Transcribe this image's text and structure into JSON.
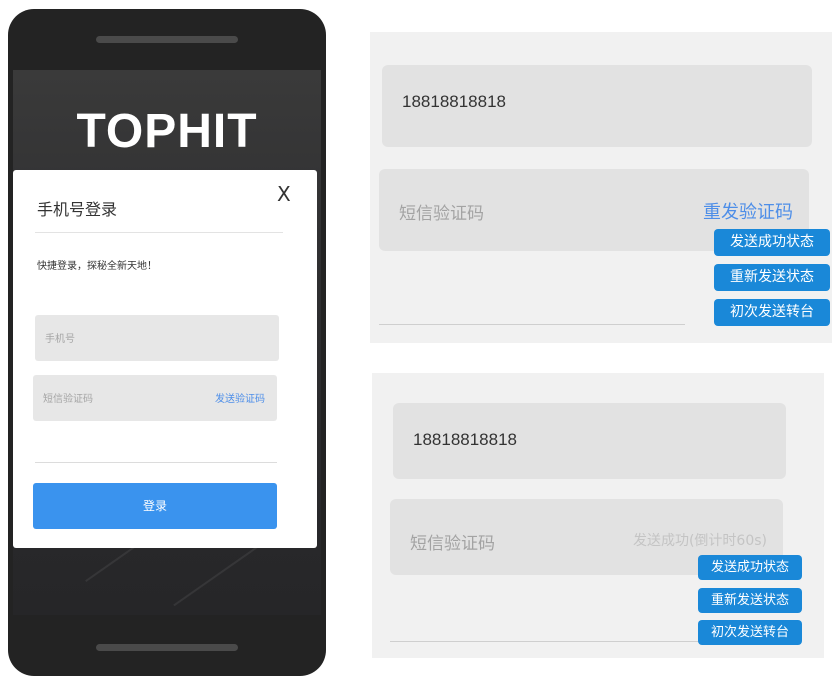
{
  "phone": {
    "logo": "TOPHIT",
    "modal": {
      "title": "手机号登录",
      "close": "X",
      "subtitle": "快捷登录，探秘全新天地！",
      "phone_placeholder": "手机号",
      "code_placeholder": "短信验证码",
      "send_code": "发送验证码",
      "login_button": "登录"
    }
  },
  "panel_resend": {
    "phone_value": "18818818818",
    "code_placeholder": "短信验证码",
    "resend_link": "重发验证码",
    "buttons": [
      "发送成功状态",
      "重新发送状态",
      "初次发送转台"
    ]
  },
  "panel_countdown": {
    "phone_value": "18818818818",
    "code_placeholder": "短信验证码",
    "countdown": "发送成功(倒计时60s)",
    "buttons": [
      "发送成功状态",
      "重新发送状态",
      "初次发送转台"
    ]
  },
  "colors": {
    "accent_blue": "#3a93ee",
    "link_blue": "#4d8ee8",
    "tag_blue": "#1a88d8"
  }
}
